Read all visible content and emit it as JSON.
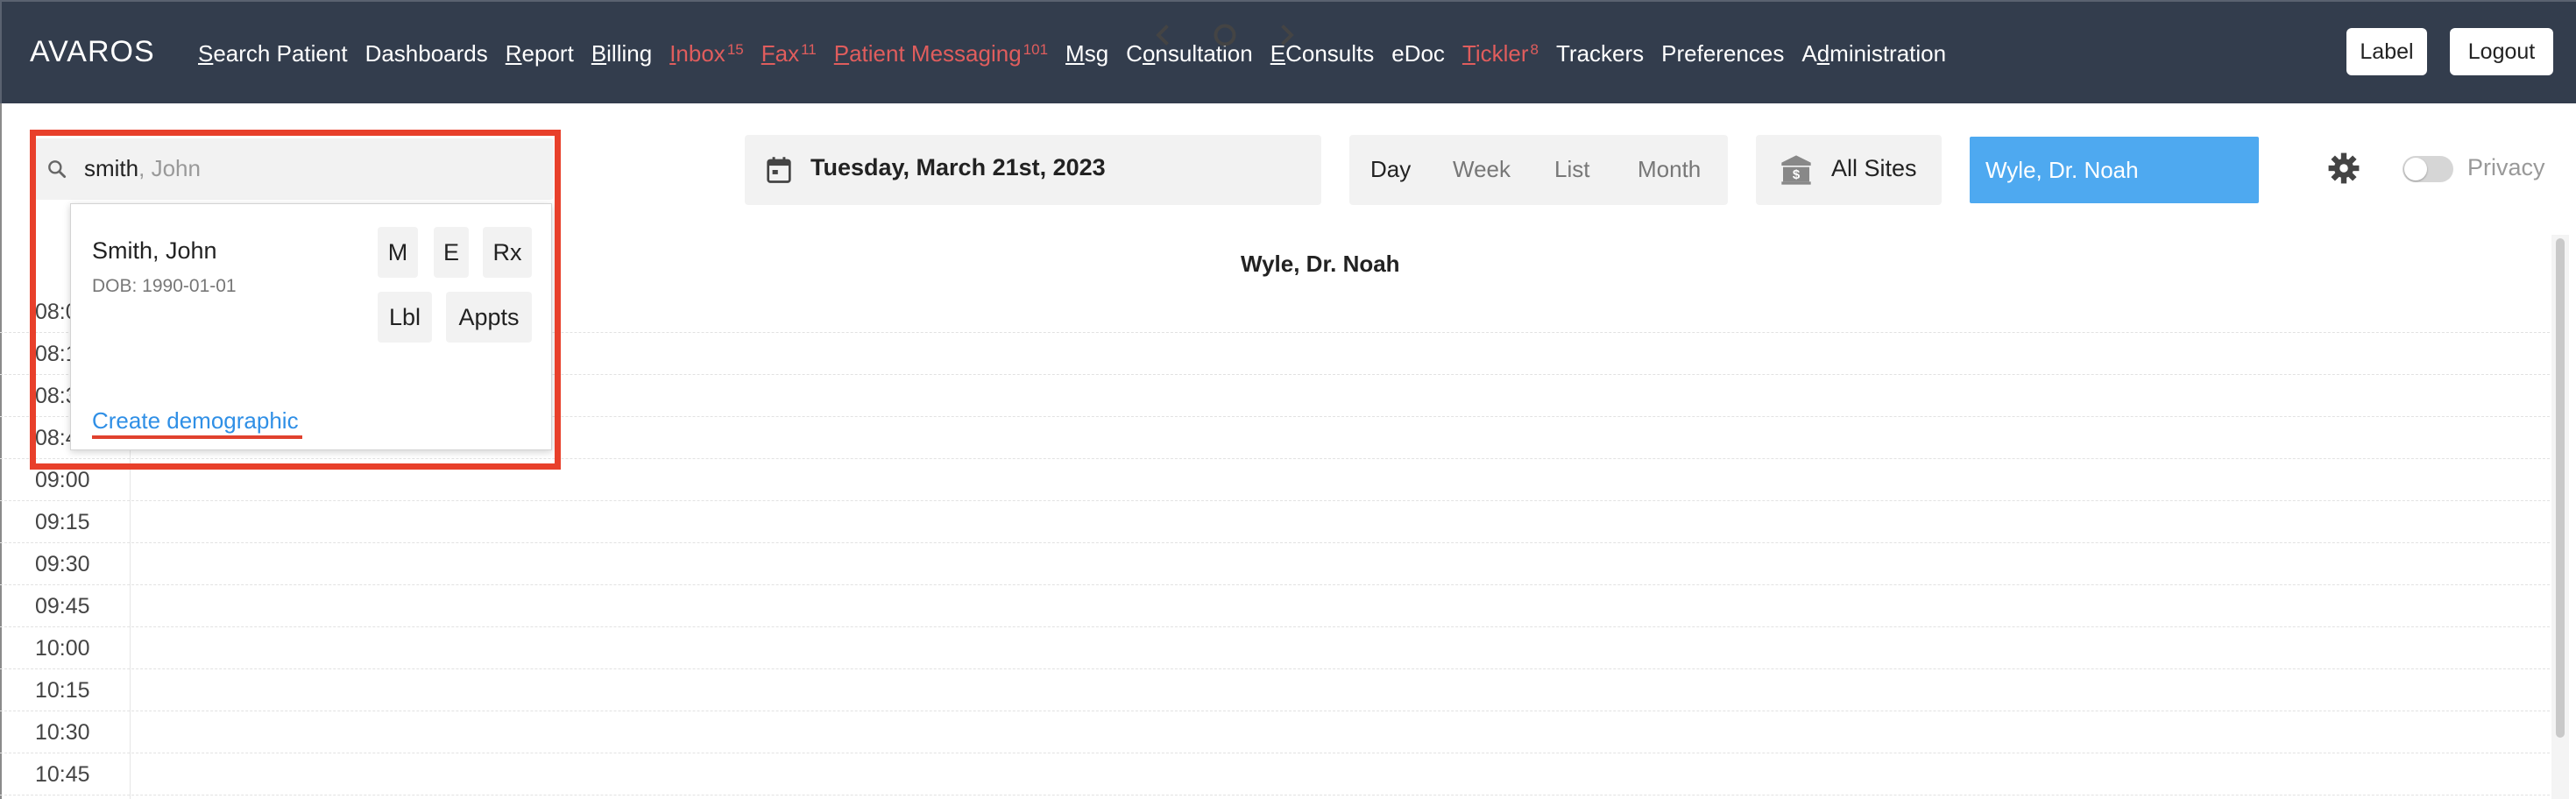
{
  "app": {
    "brand": "AVAROS"
  },
  "nav": [
    {
      "pre": "",
      "u": "S",
      "post": "earch Patient",
      "badge": "",
      "alert": false
    },
    {
      "pre": "Dashboards",
      "u": "",
      "post": "",
      "badge": "",
      "alert": false
    },
    {
      "pre": "",
      "u": "R",
      "post": "eport",
      "badge": "",
      "alert": false
    },
    {
      "pre": "",
      "u": "B",
      "post": "illing",
      "badge": "",
      "alert": false
    },
    {
      "pre": "",
      "u": "I",
      "post": "nbox",
      "badge": "15",
      "alert": true
    },
    {
      "pre": "",
      "u": "F",
      "post": "ax",
      "badge": "11",
      "alert": true
    },
    {
      "pre": "",
      "u": "P",
      "post": "atient Messaging",
      "badge": "101",
      "alert": true
    },
    {
      "pre": "",
      "u": "M",
      "post": "sg",
      "badge": "",
      "alert": false
    },
    {
      "pre": "C",
      "u": "o",
      "post": "nsultation",
      "badge": "",
      "alert": false
    },
    {
      "pre": "",
      "u": "E",
      "post": "Consults",
      "badge": "",
      "alert": false
    },
    {
      "pre": "eDoc",
      "u": "",
      "post": "",
      "badge": "",
      "alert": false
    },
    {
      "pre": "",
      "u": "T",
      "post": "ickler",
      "badge": "8",
      "alert": true
    },
    {
      "pre": "Trackers",
      "u": "",
      "post": "",
      "badge": "",
      "alert": false
    },
    {
      "pre": "Preferences",
      "u": "",
      "post": "",
      "badge": "",
      "alert": false
    },
    {
      "pre": "A",
      "u": "d",
      "post": "ministration",
      "badge": "",
      "alert": false
    }
  ],
  "header_buttons": {
    "label": "Label",
    "logout": "Logout"
  },
  "search": {
    "typed": "smith",
    "hint": ", John"
  },
  "date": {
    "text": "Tuesday, March 21st, 2023"
  },
  "views": {
    "day": "Day",
    "week": "Week",
    "list": "List",
    "month": "Month",
    "active": "Day"
  },
  "sites": {
    "label": "All Sites"
  },
  "provider": {
    "selected": "Wyle, Dr. Noah"
  },
  "privacy": {
    "label": "Privacy",
    "enabled": false
  },
  "calendar": {
    "provider_header": "Wyle, Dr. Noah",
    "times": [
      "08:00",
      "08:15",
      "08:30",
      "08:45",
      "09:00",
      "09:15",
      "09:30",
      "09:45",
      "10:00",
      "10:15",
      "10:30",
      "10:45"
    ]
  },
  "search_results": {
    "patient_name": "Smith, John",
    "dob": "DOB: 1990-01-01",
    "actions": {
      "m": "M",
      "e": "E",
      "rx": "Rx",
      "lbl": "Lbl",
      "appts": "Appts"
    },
    "create_link": "Create demographic"
  },
  "colors": {
    "nav_bg": "#333d4d",
    "alert": "#e05d5d",
    "provider_bg": "#4ea9f0",
    "highlight": "#e8402b",
    "link": "#2f8fe6"
  }
}
